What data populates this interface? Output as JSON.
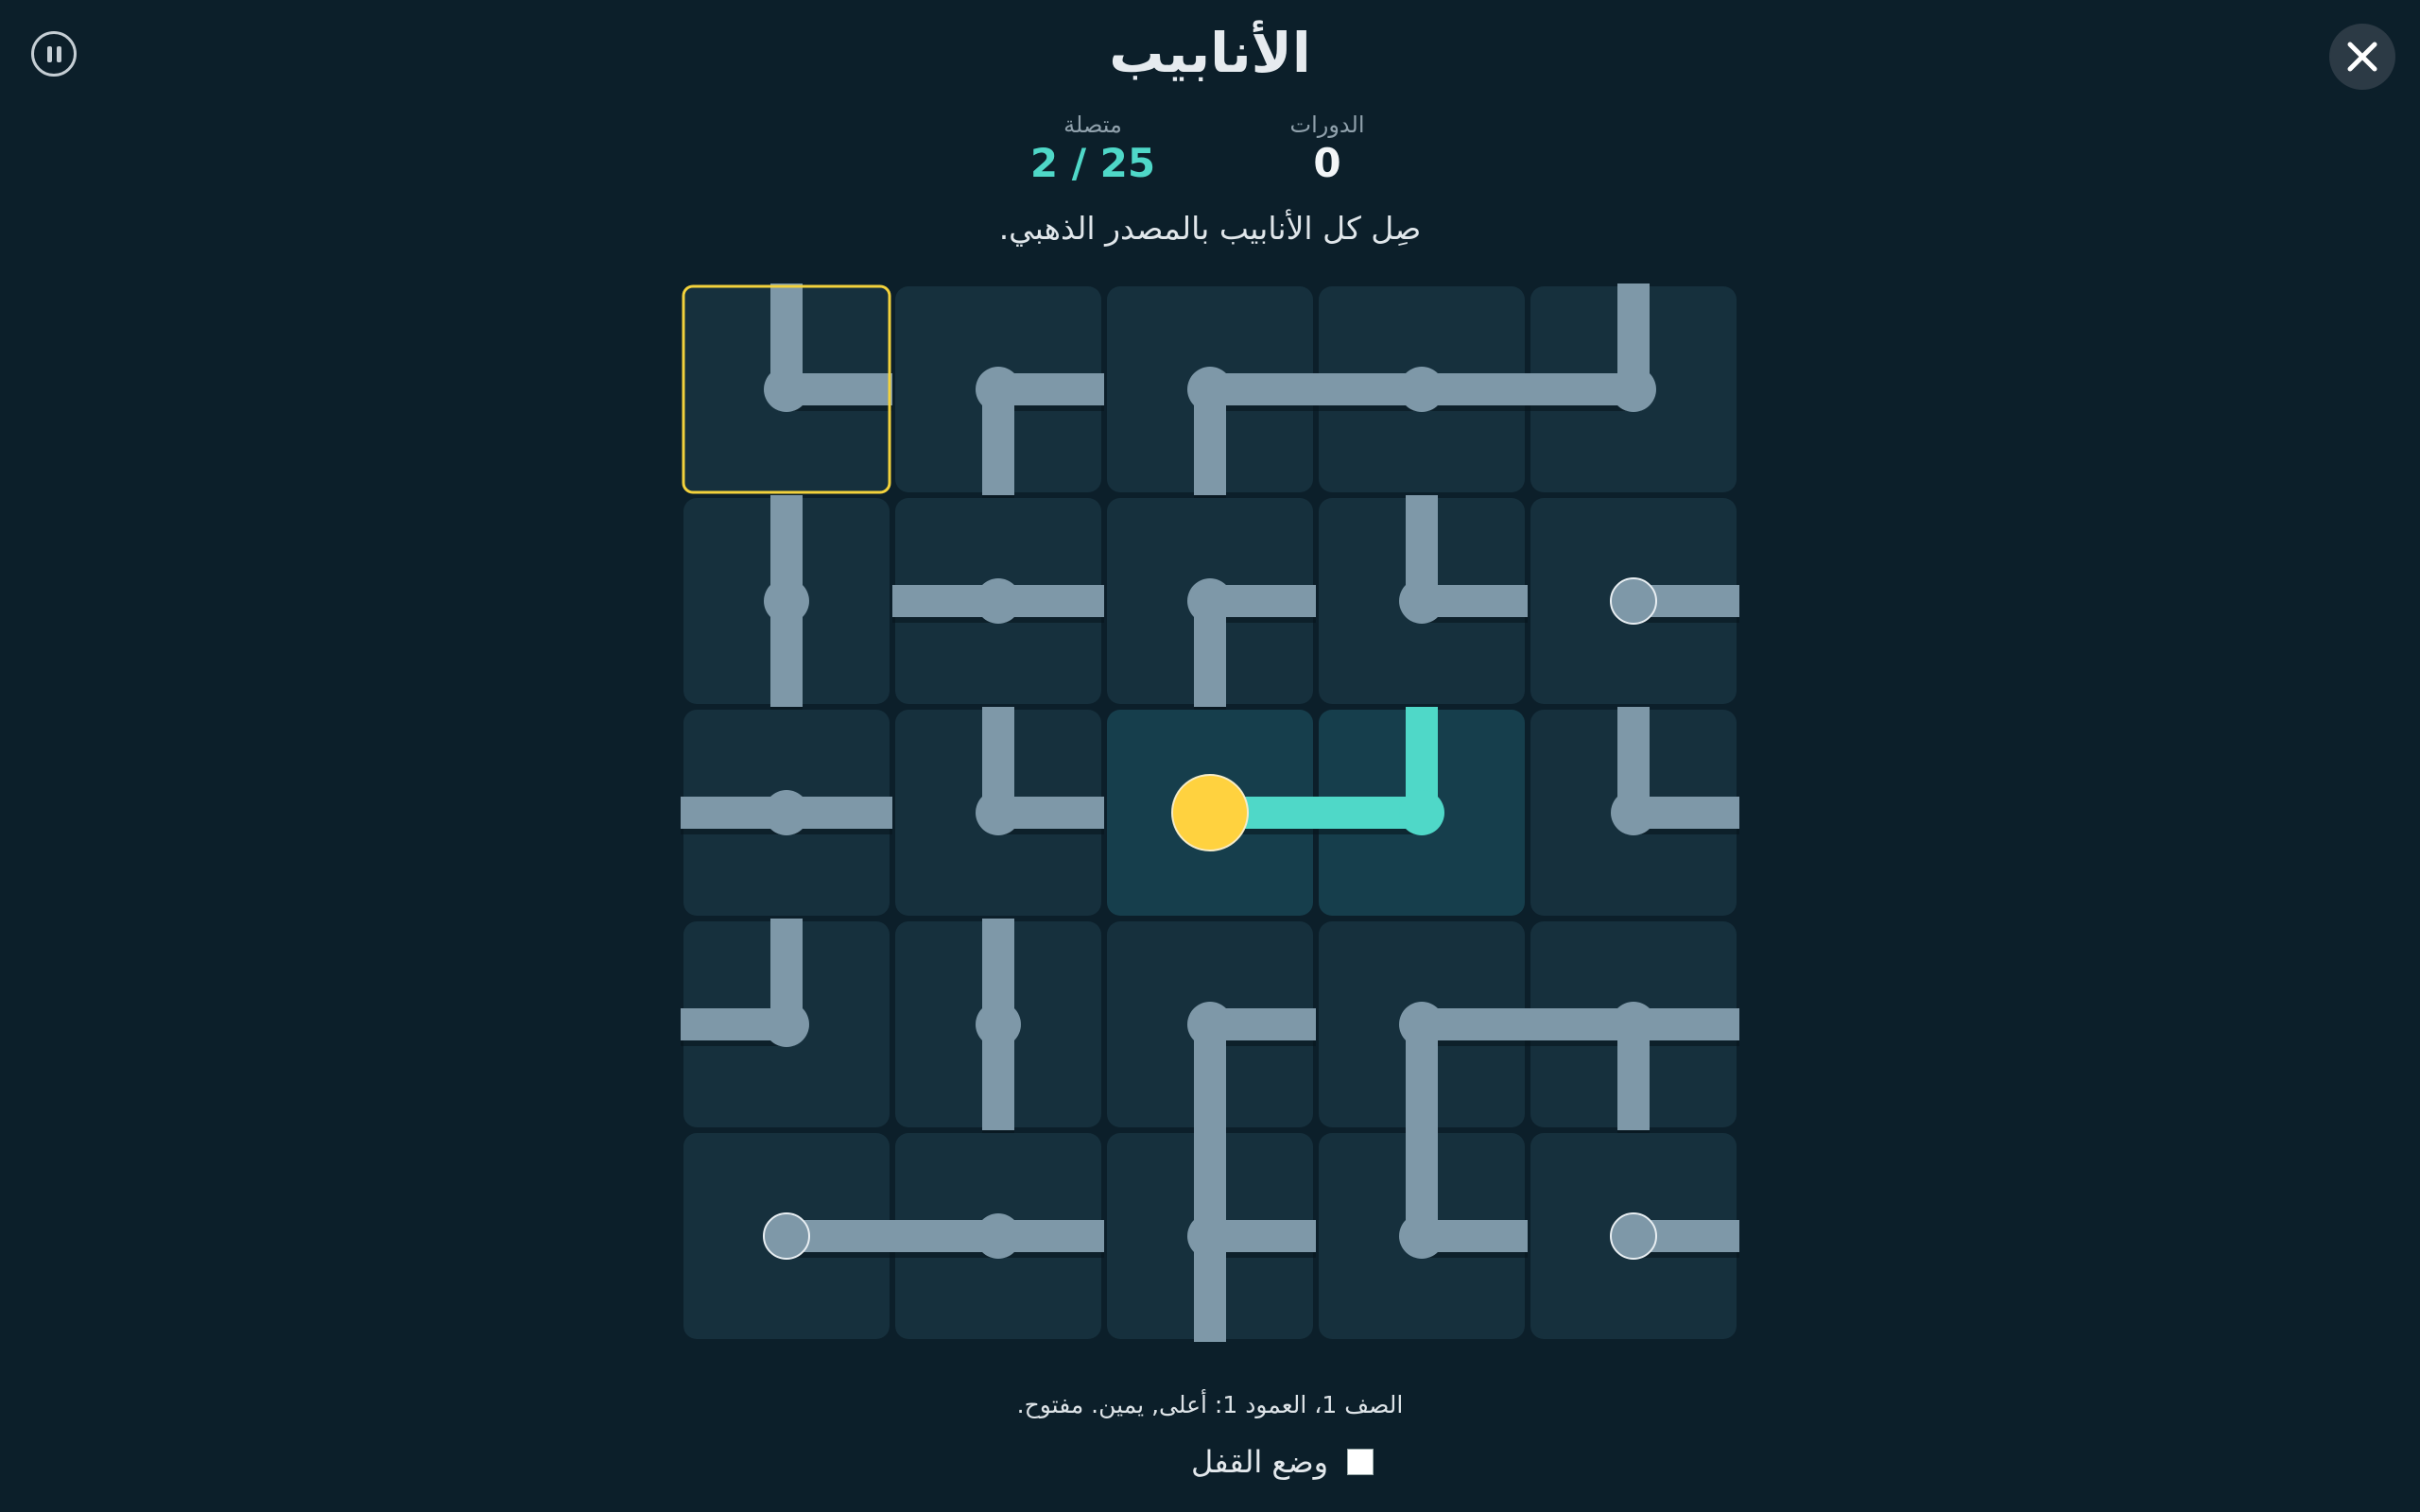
{
  "header": {
    "title": "الأنابيب",
    "stats": {
      "turns_label": "الدورات",
      "turns_value": "0",
      "connected_label": "متصلة",
      "connected_value": "2 / 25"
    },
    "instruction": "صِل كل الأنابيب بالمصدر الذهبي."
  },
  "controls": {
    "pause_icon": "pause-icon",
    "close_icon": "close-icon"
  },
  "board": {
    "rows": 5,
    "cols": 5,
    "selected": [
      0,
      0
    ],
    "source": [
      2,
      2
    ],
    "tiles": [
      [
        {
          "c": "NE"
        },
        {
          "c": "ES"
        },
        {
          "c": "ES"
        },
        {
          "c": "EW"
        },
        {
          "c": "NW"
        }
      ],
      [
        {
          "c": "NS"
        },
        {
          "c": "EW"
        },
        {
          "c": "ES"
        },
        {
          "c": "NE"
        },
        {
          "c": "E"
        }
      ],
      [
        {
          "c": "EW"
        },
        {
          "c": "NE"
        },
        {
          "c": "E",
          "lit": true,
          "source": true
        },
        {
          "c": "NW",
          "lit": true
        },
        {
          "c": "NE"
        }
      ],
      [
        {
          "c": "NW"
        },
        {
          "c": "NS"
        },
        {
          "c": "ES"
        },
        {
          "c": "ES"
        },
        {
          "c": "ESW"
        }
      ],
      [
        {
          "c": "E"
        },
        {
          "c": "EW"
        },
        {
          "c": "NES"
        },
        {
          "c": "NE"
        },
        {
          "c": "E"
        }
      ]
    ],
    "colors": {
      "tile": "#16303d",
      "tile_lit": "#163e4c",
      "pipe": "#7e98a8",
      "pipe_lit": "#4fd8c8",
      "source": "#ffd23f",
      "selection": "#f3d23c"
    }
  },
  "footer": {
    "status": "الصف 1، العمود 1: أعلى, يمين. مفتوح.",
    "lock_mode_label": "وضع القفل"
  }
}
